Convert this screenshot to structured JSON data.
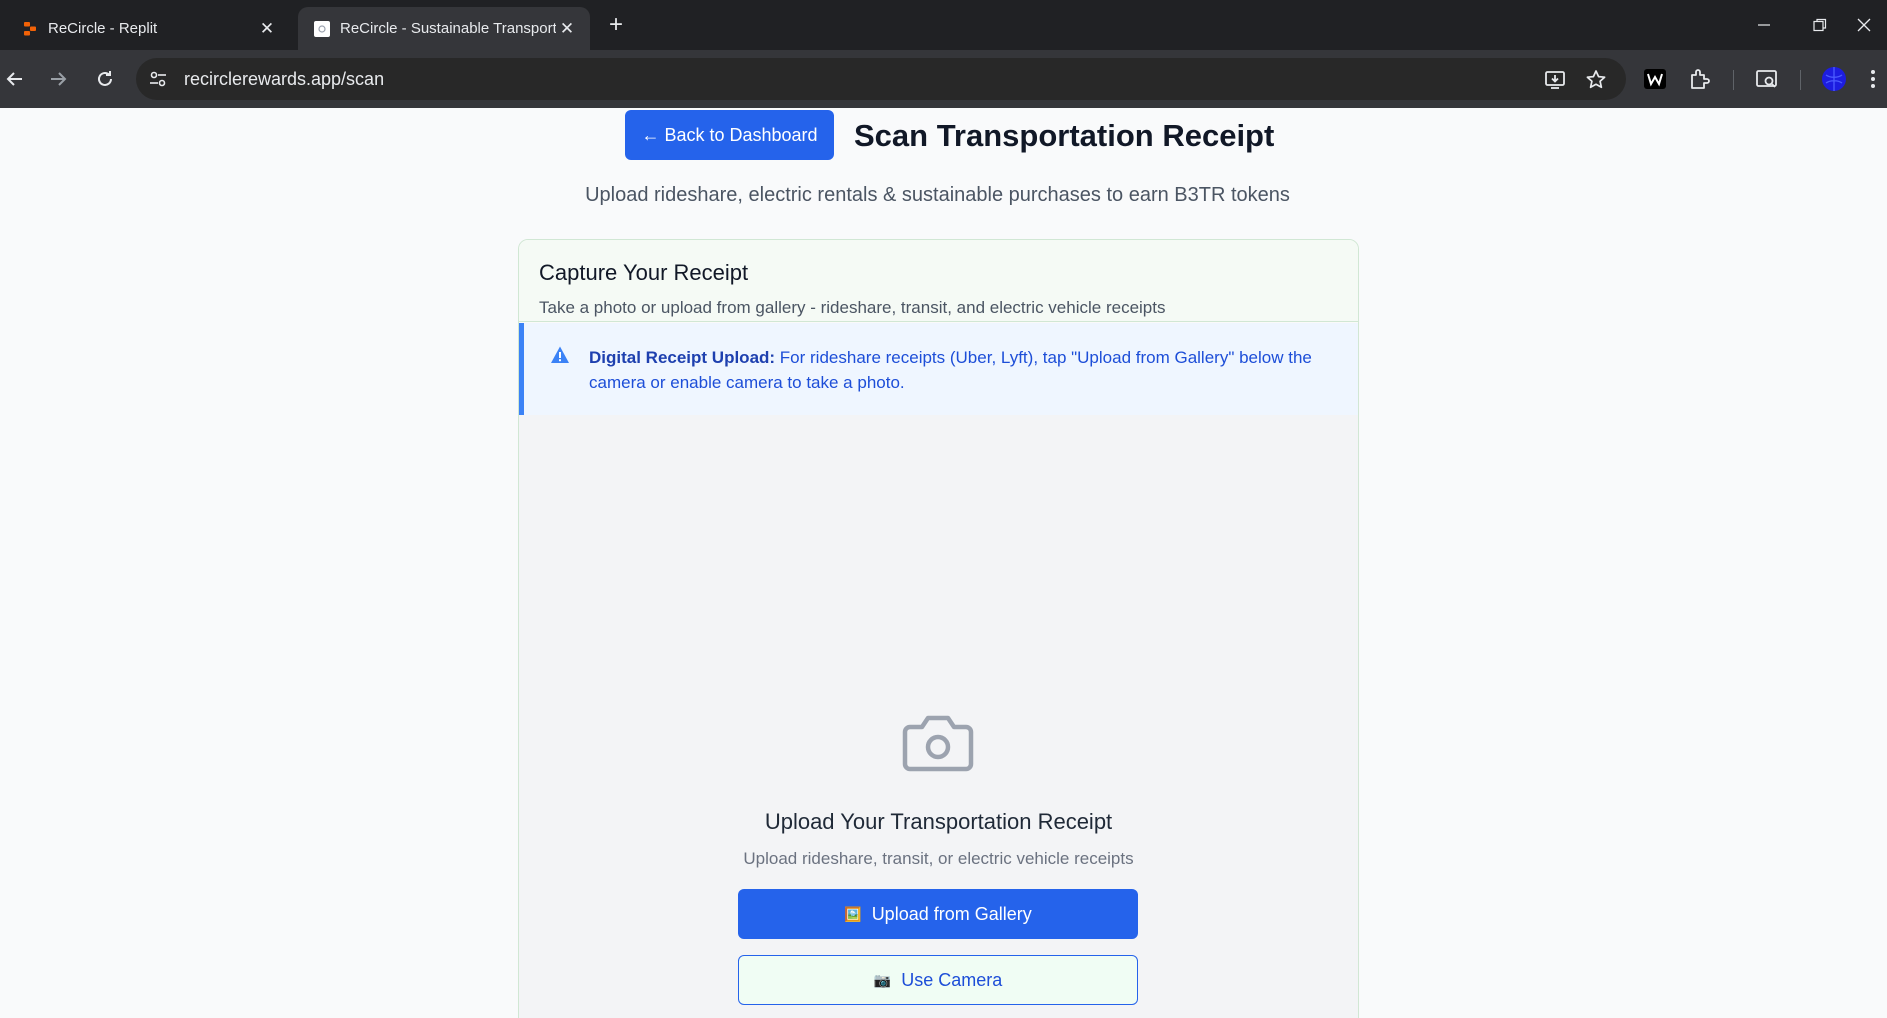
{
  "browser": {
    "tabs": [
      {
        "title": "ReCircle - Replit",
        "icon": "replit-icon"
      },
      {
        "title": "ReCircle - Sustainable Transport",
        "icon": "recircle-favicon-icon"
      }
    ],
    "new_tab": "+",
    "url": "recirclerewards.app/scan"
  },
  "page": {
    "back_button": "← Back to Dashboard",
    "title": "Scan Transportation Receipt",
    "subtitle": "Upload rideshare, electric rentals & sustainable purchases to earn B3TR tokens"
  },
  "card": {
    "title": "Capture Your Receipt",
    "description": "Take a photo or upload from gallery - rideshare, transit, and electric vehicle receipts",
    "alert": {
      "label": "Digital Receipt Upload:",
      "text": " For rideshare receipts (Uber, Lyft), tap \"Upload from Gallery\" below the camera or enable camera to take a photo."
    },
    "dropzone": {
      "icon": "camera-icon",
      "title": "Upload Your Transportation Receipt",
      "subtitle": "Upload rideshare, transit, or electric vehicle receipts",
      "gallery_button": "Upload from Gallery",
      "gallery_emoji": "🖼️",
      "camera_button": "Use Camera",
      "camera_emoji": "📷"
    }
  },
  "colors": {
    "primary": "#2563eb",
    "alert_text": "#1d4ed8",
    "card_border": "#d1e7d4"
  }
}
